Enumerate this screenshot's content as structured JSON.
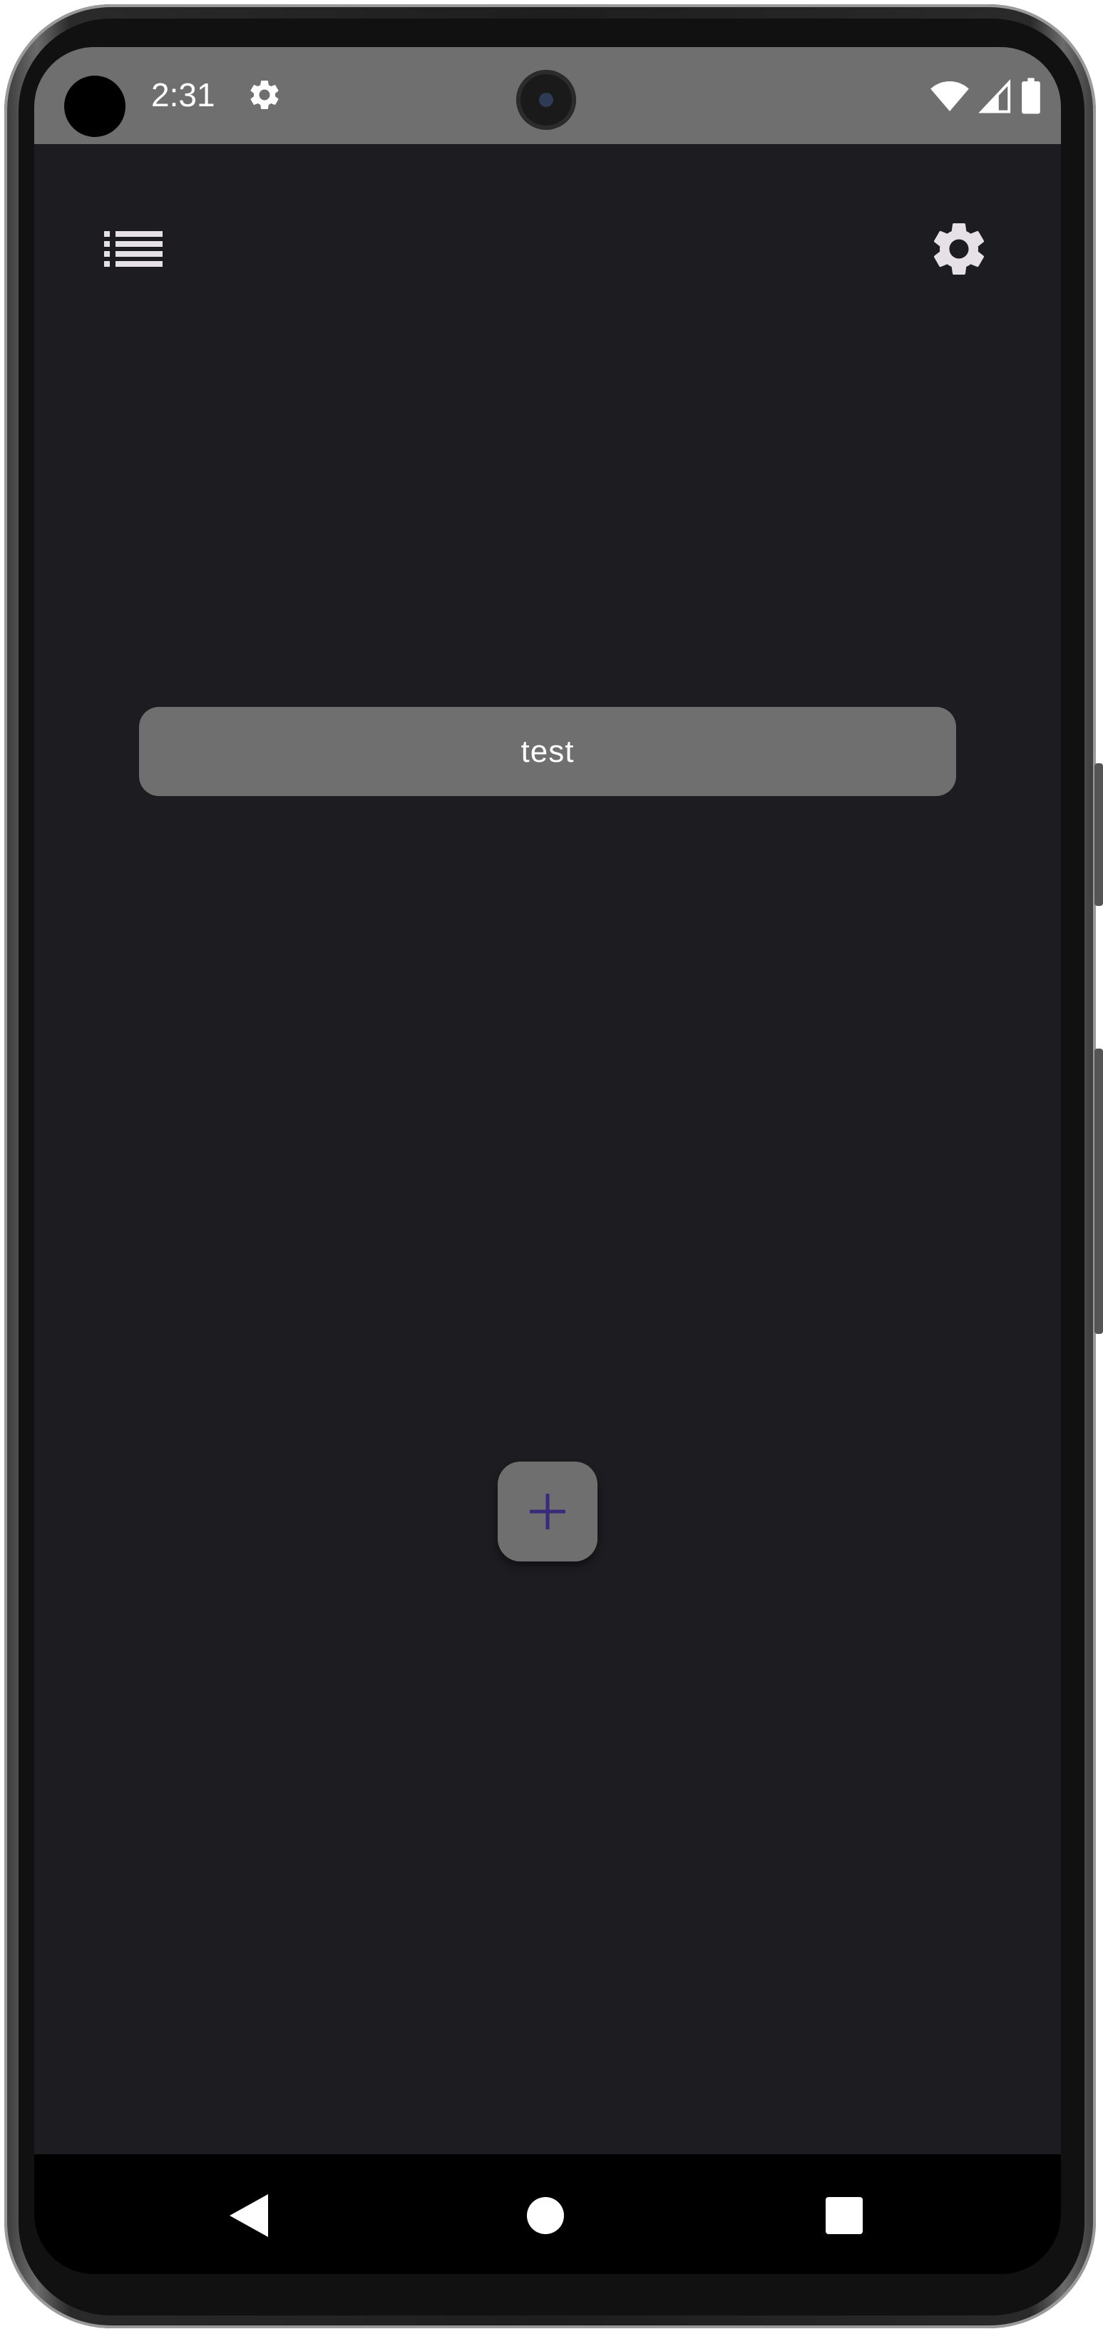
{
  "status_bar": {
    "time": "2:31",
    "icons": [
      "settings-icon",
      "wifi-icon",
      "signal-icon",
      "battery-icon"
    ]
  },
  "toolbar": {
    "menu_icon": "list-icon",
    "settings_icon": "gear-icon"
  },
  "items": [
    {
      "label": "test"
    }
  ],
  "fab": {
    "icon": "plus-icon",
    "icon_color": "#3a2a7a"
  },
  "nav_bar": {
    "icons": [
      "back-icon",
      "home-icon",
      "recents-icon"
    ]
  },
  "colors": {
    "screen_background": "#1d1c20",
    "surface": "#6f6f6f",
    "status_bar": "#6f6f6f",
    "nav_bar": "#000000",
    "text": "#ffffff"
  }
}
